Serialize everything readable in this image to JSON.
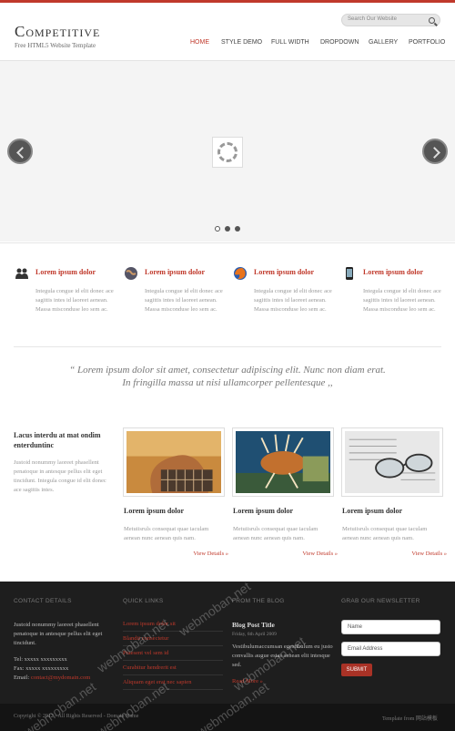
{
  "brand": {
    "logo": "Competitive",
    "tagline": "Free HTML5 Website Template"
  },
  "search": {
    "placeholder": "Search Our Website"
  },
  "nav": [
    {
      "label": "HOME",
      "active": true
    },
    {
      "label": "STYLE DEMO"
    },
    {
      "label": "FULL WIDTH"
    },
    {
      "label": "DROPDOWN"
    },
    {
      "label": "GALLERY"
    },
    {
      "label": "PORTFOLIO"
    }
  ],
  "slider": {
    "dots": 3,
    "active_dot": 0
  },
  "features": [
    {
      "icon": "users-icon",
      "title": "Lorem ipsum dolor",
      "text": "Integula congue id elit donec ace sagittis intes id laoreet aenean. Massa misconduse leo sem ac."
    },
    {
      "icon": "globe-icon",
      "title": "Lorem ipsum dolor",
      "text": "Integula congue id elit donec ace sagittis intes id laoreet aenean. Massa misconduse leo sem ac."
    },
    {
      "icon": "firefox-icon",
      "title": "Lorem ipsum dolor",
      "text": "Integula congue id elit donec ace sagittis intes id laoreet aenean. Massa misconduse leo sem ac."
    },
    {
      "icon": "phone-icon",
      "title": "Lorem ipsum dolor",
      "text": "Integula congue id elit donec ace sagittis intes id laoreet aenean. Massa misconduse leo sem ac."
    }
  ],
  "quote": {
    "line1": "“ Lorem ipsum dolor sit amet, consectetur adipiscing elit. Nunc non diam erat.",
    "line2": "In fringilla massa ut nisi ullamcorper pellentesque ,,"
  },
  "intro": {
    "title": "Lacus interdu at mat ondim enterduntinc",
    "text": "Justoid nonummy laoreet phasellent penatoque in antesque pellus elit eget tincidunt. Integula congue id elit donec ace sagittis intes."
  },
  "cards": [
    {
      "title": "Lorem ipsum dolor",
      "text": "Metuiisruls consequat quae iaculam aenean nunc aenean quis nam.",
      "link": "View Details »"
    },
    {
      "title": "Lorem ipsum dolor",
      "text": "Metuiisruls consequat quae iaculam aenean nunc aenean quis nam.",
      "link": "View Details »"
    },
    {
      "title": "Lorem ipsum dolor",
      "text": "Metuiisruls consequat quae iaculam aenean nunc aenean quis nam.",
      "link": "View Details »"
    }
  ],
  "footer": {
    "contact": {
      "heading": "CONTACT DETAILS",
      "address": "Justoid nonummy laoreet phasellent penatoque in antesque pellus elit eget tincidunt.",
      "tel": "Tel: xxxxx xxxxxxxxx",
      "fax": "Fax: xxxxx xxxxxxxxx",
      "email_label": "Email:",
      "email": "contact@mydomain.com"
    },
    "quick": {
      "heading": "QUICK LINKS",
      "links": [
        "Lorem ipsum dolor sit",
        "Blandit consectetur",
        "Praesent vel sem id",
        "Curabitur hendrerit est",
        "Aliquam eget erat nec sapien"
      ]
    },
    "blog": {
      "heading": "FROM THE BLOG",
      "title": "Blog Post Title",
      "date": "Friday, 6th April 2009",
      "text": "Vestibulumaccumsan egestibulum eu justo convallis augue estas aenean elit intesque sed.",
      "link": "Read More »"
    },
    "newsletter": {
      "heading": "GRAB OUR NEWSLETTER",
      "name_placeholder": "Name",
      "email_placeholder": "Email Address",
      "submit": "SUBMIT"
    }
  },
  "bottom": {
    "copyright": "Copyright © 2012 - All Rights Reserved - Domain Name",
    "credit": "Template from 网站模板"
  },
  "watermark": "webmoban.net",
  "colors": {
    "accent": "#c0392b",
    "footer_bg": "#1e1e1e"
  }
}
